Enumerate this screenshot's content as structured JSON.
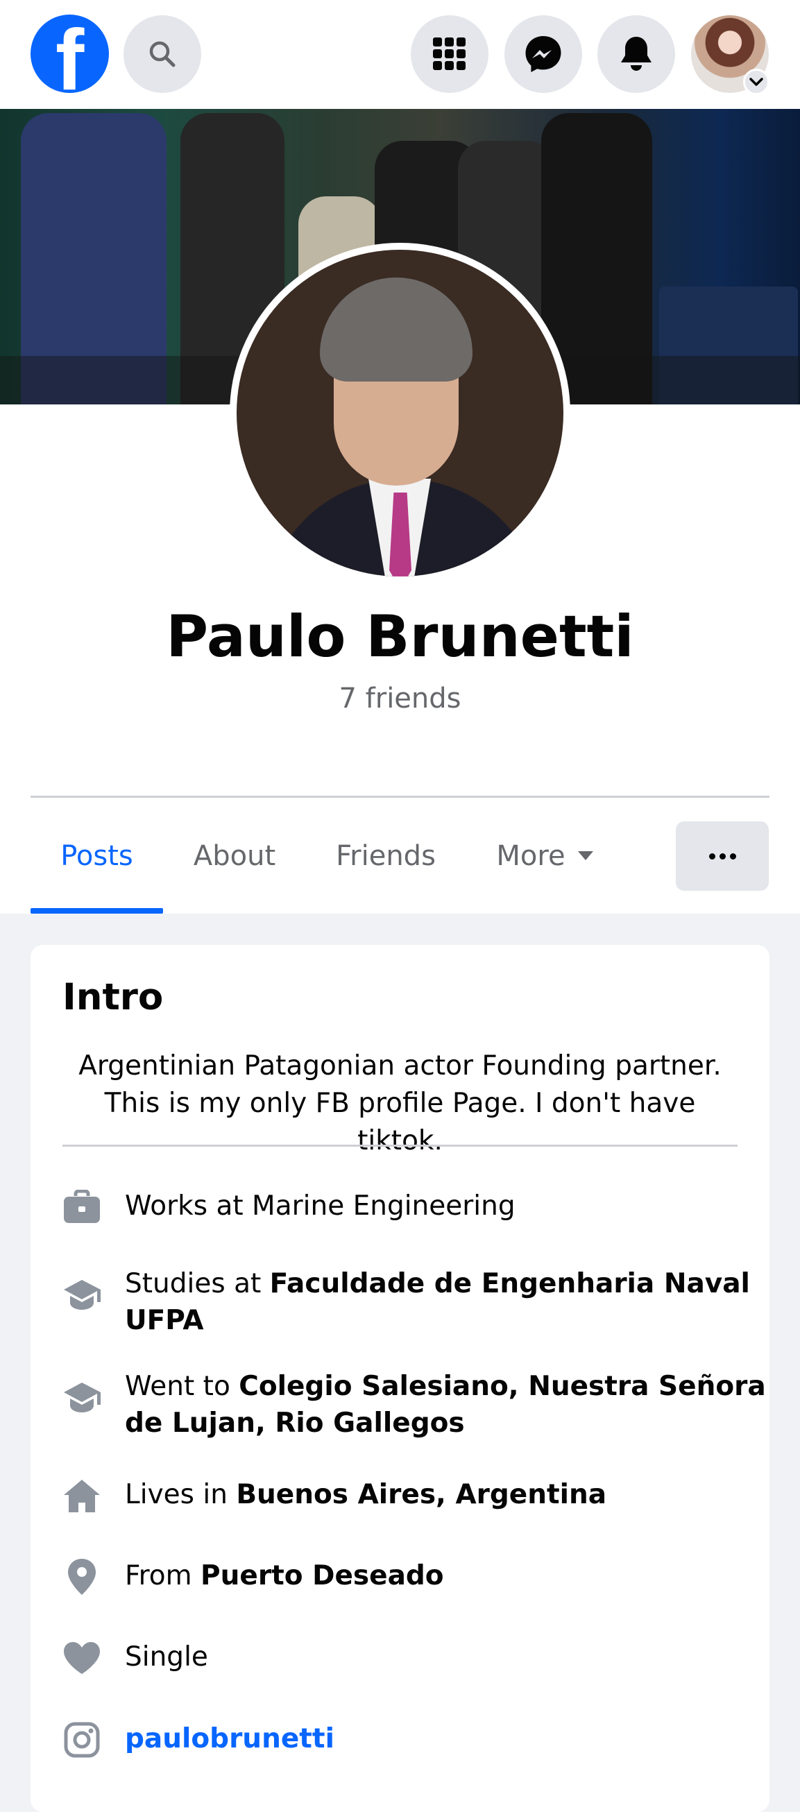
{
  "nav": {
    "logo_letter": "f",
    "icons": [
      "search-icon",
      "menu-grid-icon",
      "messenger-icon",
      "notifications-icon",
      "account-avatar",
      "chevron-down-icon"
    ]
  },
  "profile": {
    "name": "Paulo Brunetti",
    "friends": "7 friends"
  },
  "tabs": {
    "posts": "Posts",
    "about": "About",
    "friends": "Friends",
    "more": "More"
  },
  "intro": {
    "title": "Intro",
    "bio": "Argentinian Patagonian actor Founding partner. This is my only FB profile Page. I don't have tiktok.",
    "work": "Works at Marine Engineering",
    "study_prefix": "Studies at ",
    "study_place": "Faculdade de Engenharia Naval UFPA",
    "went_prefix": "Went to ",
    "went_place": "Colegio Salesiano, Nuestra Señora de Lujan, Rio Gallegos",
    "lives_prefix": "Lives in ",
    "lives_place": "Buenos Aires, Argentina",
    "from_prefix": "From ",
    "from_place": "Puerto Deseado",
    "relationship": "Single",
    "instagram": "paulobrunetti"
  },
  "colors": {
    "accent": "#0866ff",
    "secondary_text": "#65676b",
    "icon_gray": "#8c939d",
    "background": "#f0f2f5"
  }
}
